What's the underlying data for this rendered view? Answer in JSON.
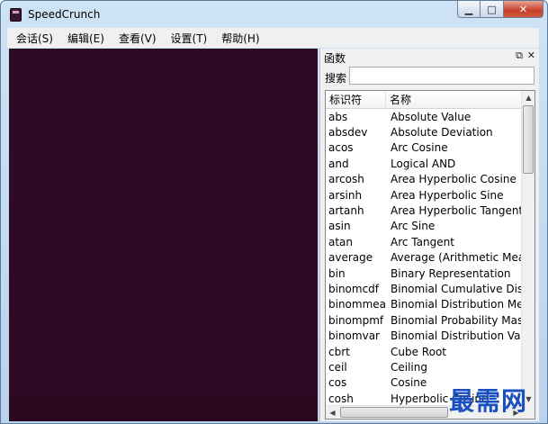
{
  "window": {
    "title": "SpeedCrunch"
  },
  "menubar": {
    "items": [
      {
        "label": "会话(S)"
      },
      {
        "label": "编辑(E)"
      },
      {
        "label": "查看(V)"
      },
      {
        "label": "设置(T)"
      },
      {
        "label": "帮助(H)"
      }
    ]
  },
  "functions_panel": {
    "title": "函数",
    "search_label": "搜索",
    "search_value": "",
    "columns": {
      "id": "标识符",
      "name": "名称"
    },
    "rows": [
      {
        "id": "abs",
        "name": "Absolute Value"
      },
      {
        "id": "absdev",
        "name": "Absolute Deviation"
      },
      {
        "id": "acos",
        "name": "Arc Cosine"
      },
      {
        "id": "and",
        "name": "Logical AND"
      },
      {
        "id": "arcosh",
        "name": "Area Hyperbolic Cosine"
      },
      {
        "id": "arsinh",
        "name": "Area Hyperbolic Sine"
      },
      {
        "id": "artanh",
        "name": "Area Hyperbolic Tangent"
      },
      {
        "id": "asin",
        "name": "Arc Sine"
      },
      {
        "id": "atan",
        "name": "Arc Tangent"
      },
      {
        "id": "average",
        "name": "Average (Arithmetic Mean)"
      },
      {
        "id": "bin",
        "name": "Binary Representation"
      },
      {
        "id": "binomcdf",
        "name": "Binomial Cumulative Distrib"
      },
      {
        "id": "binommean",
        "name": "Binomial Distribution Mean"
      },
      {
        "id": "binompmf",
        "name": "Binomial Probability Mass F"
      },
      {
        "id": "binomvar",
        "name": "Binomial Distribution Variar"
      },
      {
        "id": "cbrt",
        "name": "Cube Root"
      },
      {
        "id": "ceil",
        "name": "Ceiling"
      },
      {
        "id": "cos",
        "name": "Cosine"
      },
      {
        "id": "cosh",
        "name": "Hyperbolic Cosine"
      }
    ]
  },
  "watermark": {
    "text": "最需网"
  },
  "colors": {
    "editor_bg": "#300a24",
    "titlebar": "#c4dbf3",
    "close_btn": "#c6402a"
  }
}
